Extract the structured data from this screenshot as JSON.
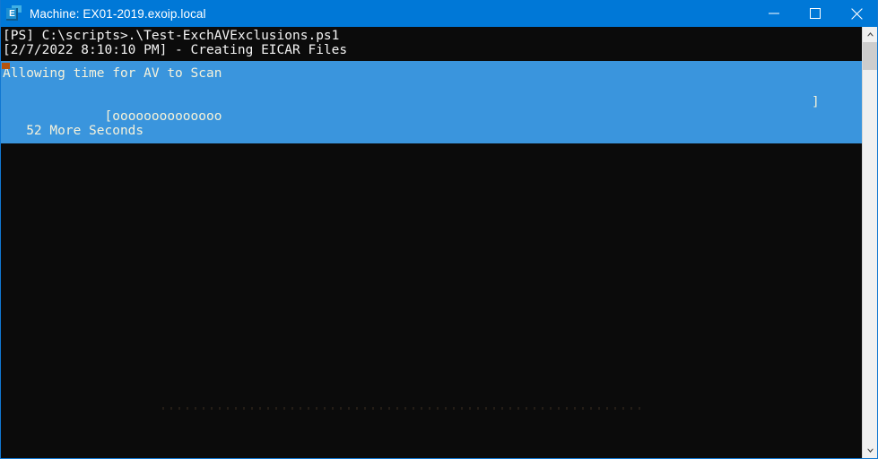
{
  "window": {
    "title": "Machine: EX01-2019.exoip.local",
    "icon": "exchange-e-icon",
    "icon_letter": "E",
    "accent_color": "#0078d7",
    "border_color": "#1177d1",
    "controls": {
      "minimize": "minimize-icon",
      "maximize": "maximize-icon",
      "close": "close-icon"
    }
  },
  "console": {
    "background_color": "#0b0b0b",
    "foreground_color": "#f2f2f2",
    "highlight_background_color": "#3a95dd",
    "highlight_foreground_color": "#f5f2dc",
    "marker_color": "#b5540f",
    "lines": [
      "[PS] C:\\scripts>.\\Test-ExchAVExclusions.ps1",
      "[2/7/2022 8:10:10 PM] - Creating EICAR Files"
    ],
    "highlight": {
      "heading": "Allowing time for AV to Scan",
      "progress_open": "   [oooooooooooooo",
      "progress_close": "]",
      "progress_fill_char": "o",
      "progress_fill_count": 14,
      "countdown": "   52 More Seconds"
    }
  },
  "scrollbar": {
    "up_arrow": "chevron-up-icon",
    "down_arrow": "chevron-down-icon",
    "thumb": "scrollbar-thumb",
    "track_color": "#f0f0f0",
    "thumb_color": "#cdcdcd"
  }
}
